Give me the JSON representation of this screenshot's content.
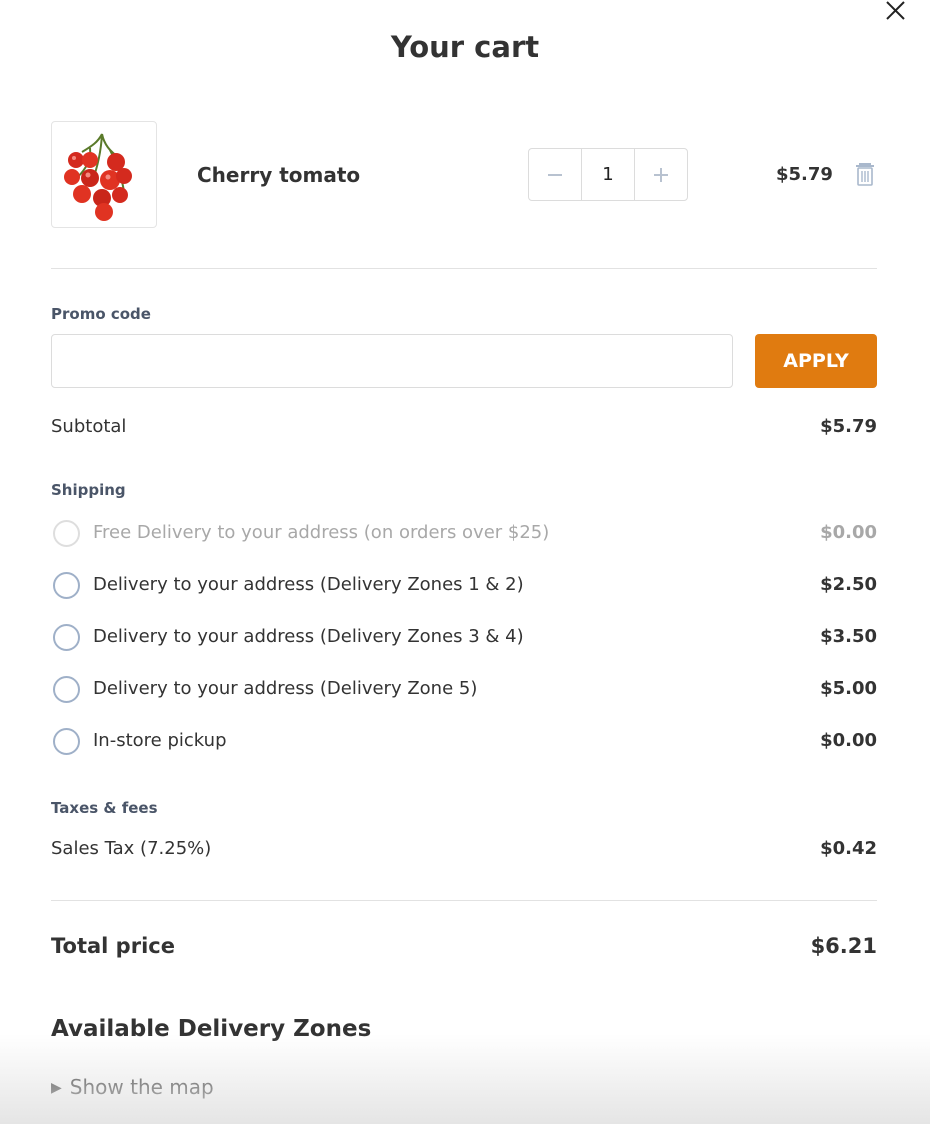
{
  "cart": {
    "title": "Your cart",
    "item": {
      "name": "Cherry tomato",
      "quantity": "1",
      "price": "$5.79",
      "decrement_icon": "minus-icon",
      "increment_icon": "plus-icon",
      "remove_icon": "trash-icon",
      "image_icon": "cherry-tomato-image"
    }
  },
  "promo": {
    "label": "Promo code",
    "value": "",
    "apply_label": "APPLY"
  },
  "subtotal": {
    "label": "Subtotal",
    "value": "$5.79"
  },
  "shipping": {
    "label": "Shipping",
    "options": [
      {
        "label": "Free Delivery to your address (on orders over $25)",
        "price": "$0.00",
        "disabled": true
      },
      {
        "label": "Delivery to your address (Delivery Zones 1 & 2)",
        "price": "$2.50",
        "disabled": false
      },
      {
        "label": "Delivery to your address (Delivery Zones 3 & 4)",
        "price": "$3.50",
        "disabled": false
      },
      {
        "label": "Delivery to your address (Delivery Zone 5)",
        "price": "$5.00",
        "disabled": false
      },
      {
        "label": "In-store pickup",
        "price": "$0.00",
        "disabled": false
      }
    ]
  },
  "taxes": {
    "label": "Taxes & fees",
    "sales_tax_label": "Sales Tax (7.25%)",
    "sales_tax_value": "$0.42"
  },
  "total": {
    "label": "Total price",
    "value": "$6.21"
  },
  "zones": {
    "title": "Available Delivery Zones",
    "toggle_label": "Show the map"
  },
  "colors": {
    "accent": "#e07b10",
    "radio_border": "#9fb0c8",
    "section_label": "#4a5568"
  }
}
